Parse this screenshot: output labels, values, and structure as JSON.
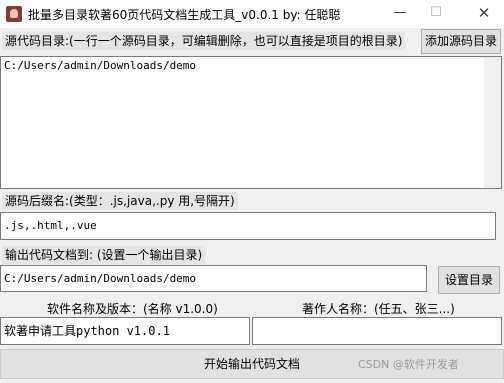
{
  "window": {
    "title": "批量多目录软著60页代码文档生成工具_v0.0.1    by: 任聪聪",
    "minimize": "—",
    "maximize": "☐",
    "close": "✕"
  },
  "source": {
    "label": "源代码目录:(一行一个源码目录，可编辑删除，也可以直接是项目的根目录)",
    "add_button": "添加源码目录",
    "value": "C:/Users/admin/Downloads/demo"
  },
  "suffix": {
    "label": "源码后缀名:(类型：.js,java,.py 用,号隔开)",
    "value": ".js,.html,.vue"
  },
  "output": {
    "label": "输出代码文档到: (设置一个输出目录)",
    "value": "C:/Users/admin/Downloads/demo",
    "set_button": "设置目录"
  },
  "software": {
    "label": "软件名称及版本：(名称 v1.0.0)",
    "value": "软著申请工具python v1.0.1"
  },
  "author": {
    "label": "著作人名称：(任五、张三...)",
    "value": "任五"
  },
  "start_button": "开始输出代码文档",
  "watermark": "CSDN @软件开发者"
}
